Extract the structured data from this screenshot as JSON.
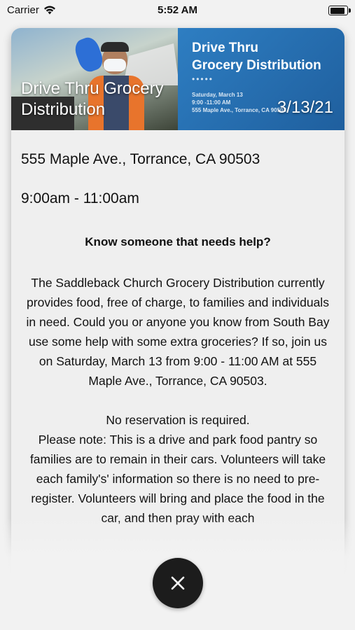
{
  "status_bar": {
    "carrier": "Carrier",
    "time": "5:52 AM"
  },
  "banner": {
    "flyer_title_line1": "Drive Thru",
    "flyer_title_line2": "Grocery Distribution",
    "flyer_dots": "•••••",
    "flyer_date": "Saturday, March 13",
    "flyer_time": "9:00 -11:00 AM",
    "flyer_address": "555 Maple Ave., Torrance, CA 90503",
    "event_title": "Drive Thru Grocery Distribution",
    "event_date": "3/13/21"
  },
  "event": {
    "address": "555 Maple Ave., Torrance, CA 90503",
    "hours": "9:00am - 11:00am",
    "heading": "Know someone that needs help?",
    "description_p1": "The Saddleback Church Grocery Distribution currently provides food, free of charge, to families and individuals in need. Could you or anyone you know from South Bay use some help with some extra groceries? If so, join us on Saturday, March 13 from 9:00 - 11:00 AM at 555 Maple Ave., Torrance, CA 90503.",
    "description_p2": "No reservation is required.",
    "description_p3": "Please note: This is a drive and park food pantry so families are to remain in their cars. Volunteers will take each family's' information so there is no need to pre-register. Volunteers will bring and place the food in the car, and then pray with each"
  },
  "colors": {
    "flyer_blue": "#1f5f9e",
    "close_button": "#1c1c1c"
  },
  "icons": {
    "close": "close-icon",
    "wifi": "wifi-icon",
    "battery": "battery-icon"
  }
}
